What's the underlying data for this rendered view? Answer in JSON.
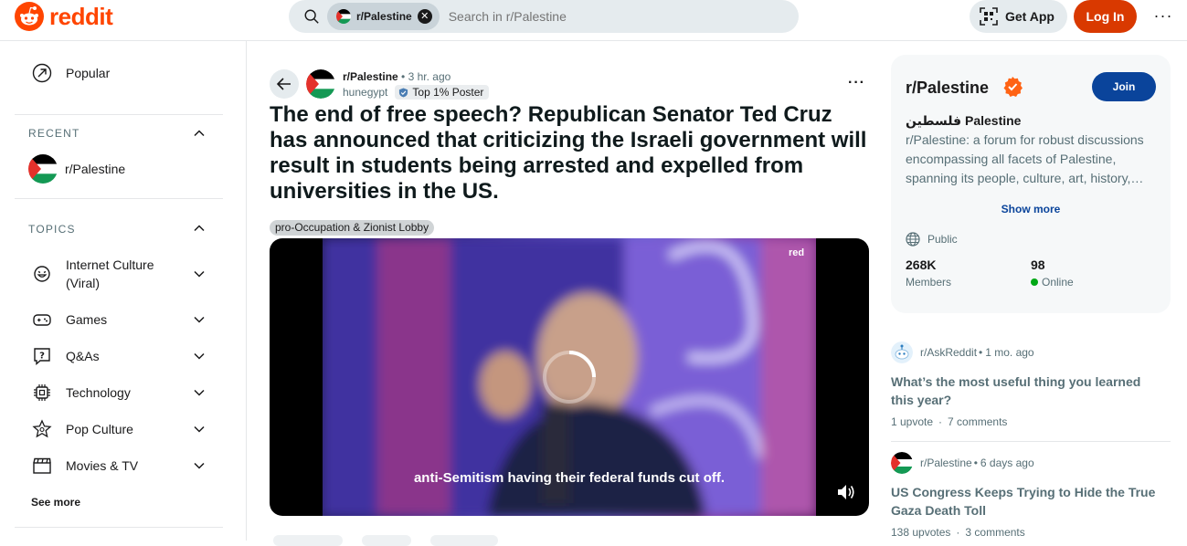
{
  "header": {
    "logo_text": "reddit",
    "search_chip": "r/Palestine",
    "search_placeholder": "Search in r/Palestine",
    "get_app_label": "Get App",
    "login_label": "Log In",
    "more_label": "···"
  },
  "sidebar": {
    "popular_label": "Popular",
    "recent_heading": "RECENT",
    "recent_items": [
      {
        "label": "r/Palestine"
      }
    ],
    "topics_heading": "TOPICS",
    "topics": [
      {
        "label": "Internet Culture (Viral)",
        "icon": "viral-face-icon"
      },
      {
        "label": "Games",
        "icon": "gamepad-icon"
      },
      {
        "label": "Q&As",
        "icon": "question-bubble-icon"
      },
      {
        "label": "Technology",
        "icon": "chip-icon"
      },
      {
        "label": "Pop Culture",
        "icon": "star-badge-icon"
      },
      {
        "label": "Movies & TV",
        "icon": "clapperboard-icon"
      }
    ],
    "see_more_label": "See more"
  },
  "post": {
    "subreddit": "r/Palestine",
    "time": "3 hr. ago",
    "author": "hunegypt",
    "author_badge": "Top 1% Poster",
    "title": "The end of free speech? Republican Senator Ted Cruz has announced that criticizing the Israeli government will result in students being arrested and expelled from universities in the US.",
    "flair": "pro-Occupation & Zionist Lobby",
    "video": {
      "caption": "anti-Semitism having their federal funds cut off.",
      "brand": "red",
      "muted": true
    }
  },
  "community": {
    "name": "r/Palestine",
    "join_label": "Join",
    "subtitle": "فلسطين Palestine",
    "description": "r/Palestine: a forum for robust discussions encompassing all facets of Palestine, spanning its people, culture, art, history,…",
    "show_more_label": "Show more",
    "visibility": "Public",
    "members_value": "268K",
    "members_label": "Members",
    "online_value": "98",
    "online_label": "Online"
  },
  "related_posts": [
    {
      "subreddit": "r/AskReddit",
      "time": "1 mo. ago",
      "title": "What’s the most useful thing you learned this year?",
      "upvotes": "1 upvote",
      "comments": "7 comments"
    },
    {
      "subreddit": "r/Palestine",
      "time": "6 days ago",
      "title": "US Congress Keeps Trying to Hide the True Gaza Death Toll",
      "upvotes": "138 upvotes",
      "comments": "3 comments"
    }
  ],
  "colors": {
    "brand": "#ff4500",
    "login": "#d93900",
    "join": "#0a449b",
    "online_dot": "#01a816"
  }
}
